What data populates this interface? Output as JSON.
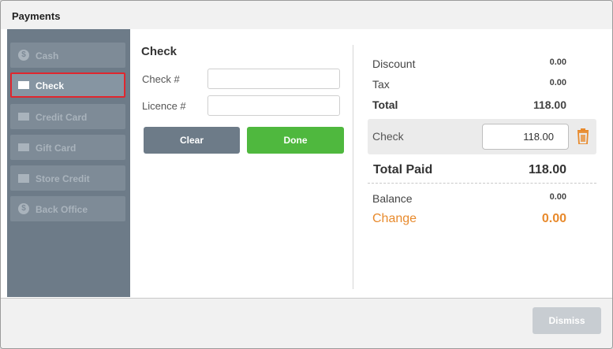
{
  "window": {
    "title": "Payments"
  },
  "sidebar": {
    "items": [
      {
        "label": "Cash",
        "icon": "dollar-coin-icon",
        "active": false
      },
      {
        "label": "Check",
        "icon": "check-card-icon",
        "active": true
      },
      {
        "label": "Credit Card",
        "icon": "credit-card-icon",
        "active": false
      },
      {
        "label": "Gift Card",
        "icon": "gift-card-icon",
        "active": false
      },
      {
        "label": "Store Credit",
        "icon": "store-icon",
        "active": false
      },
      {
        "label": "Back Office",
        "icon": "dollar-coin-icon",
        "active": false
      }
    ]
  },
  "check_form": {
    "title": "Check",
    "check_number_label": "Check #",
    "check_number_value": "",
    "licence_label": "Licence #",
    "licence_value": "",
    "clear_label": "Clear",
    "done_label": "Done"
  },
  "summary": {
    "discount_label": "Discount",
    "discount_value": "0.00",
    "tax_label": "Tax",
    "tax_value": "0.00",
    "total_label": "Total",
    "total_value": "118.00",
    "payment_label": "Check",
    "payment_amount": "118.00",
    "payment_delete_icon": "trash-icon",
    "total_paid_label": "Total Paid",
    "total_paid_value": "118.00",
    "balance_label": "Balance",
    "balance_value": "0.00",
    "change_label": "Change",
    "change_value": "0.00"
  },
  "footer": {
    "dismiss_label": "Dismiss"
  },
  "colors": {
    "sidebar_bg": "#6d7b88",
    "active_border": "#e0262e",
    "done_green": "#4fb83e",
    "change_orange": "#e88a2c"
  }
}
